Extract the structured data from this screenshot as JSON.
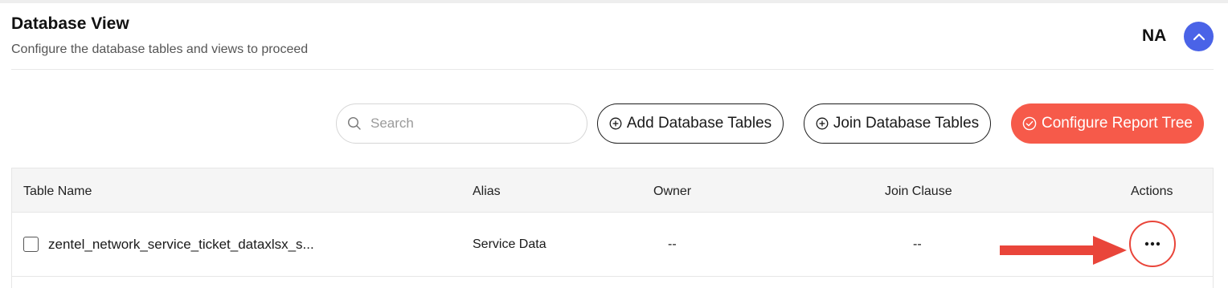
{
  "header": {
    "title": "Database View",
    "subtitle": "Configure the database tables and views to proceed",
    "user_initials": "NA"
  },
  "toolbar": {
    "search_placeholder": "Search",
    "add_tables_label": "Add Database Tables",
    "join_tables_label": "Join Database Tables",
    "configure_report_label": "Configure Report Tree"
  },
  "table": {
    "columns": [
      "Table Name",
      "Alias",
      "Owner",
      "Join Clause",
      "Actions"
    ],
    "rows": [
      {
        "table_name": "zentel_network_service_ticket_dataxlsx_s...",
        "alias": "Service Data",
        "owner": "--",
        "join_clause": "--"
      }
    ]
  },
  "colors": {
    "primary": "#f65a4a",
    "accent_blue": "#4a63e7",
    "highlight_red": "#e9453a"
  },
  "icons": {
    "collapse": "chevron-up-icon",
    "search": "search-icon",
    "add": "plus-circle-icon",
    "join": "plus-circle-icon",
    "configure": "check-circle-icon",
    "actions": "more-horizontal-icon",
    "annotation": "arrow-right-icon"
  }
}
